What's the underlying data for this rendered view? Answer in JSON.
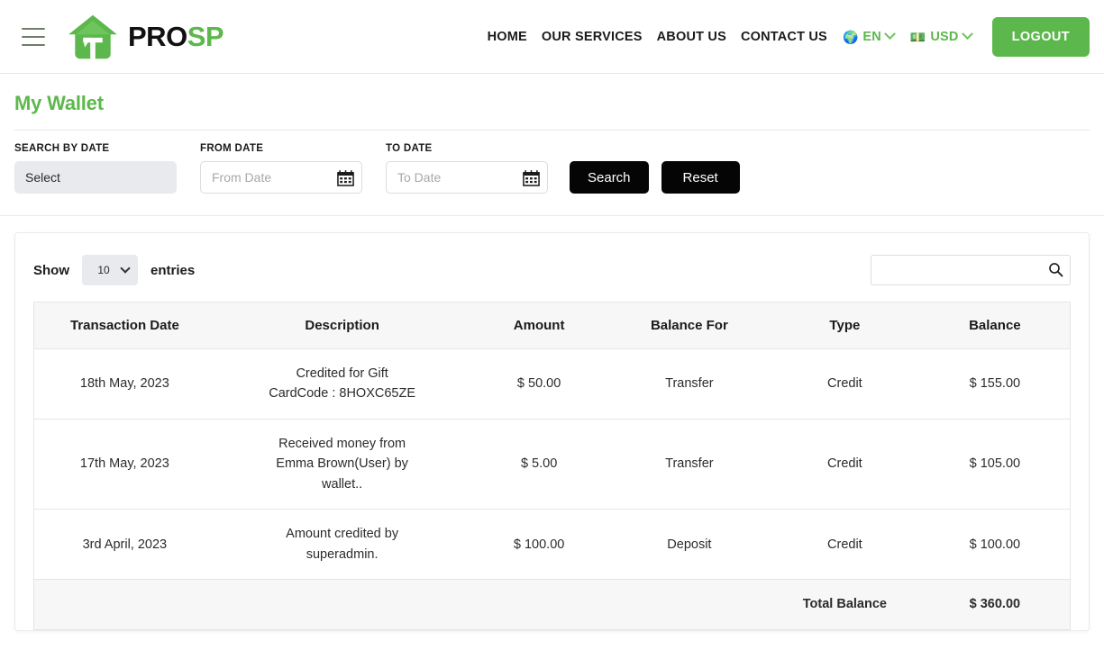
{
  "header": {
    "menu_icon": "hamburger-icon",
    "brand": {
      "part1": "PRO",
      "part2": "SP",
      "logo_icon": "house-tool-logo-icon"
    },
    "nav": [
      {
        "label": "HOME"
      },
      {
        "label": "OUR SERVICES"
      },
      {
        "label": "ABOUT US"
      },
      {
        "label": "CONTACT US"
      }
    ],
    "language": {
      "emoji": "🌍",
      "code": "EN",
      "icon": "globe-icon"
    },
    "currency": {
      "emoji": "💵",
      "code": "USD",
      "icon": "banknote-icon"
    },
    "logout_label": "LOGOUT"
  },
  "page": {
    "title": "My Wallet"
  },
  "filters": {
    "search_by_date": {
      "label": "SEARCH BY DATE",
      "value": "Select"
    },
    "from_date": {
      "label": "FROM DATE",
      "placeholder": "From Date",
      "value": "",
      "icon": "calendar-icon"
    },
    "to_date": {
      "label": "TO DATE",
      "placeholder": "To Date",
      "value": "",
      "icon": "calendar-icon"
    },
    "search_label": "Search",
    "reset_label": "Reset"
  },
  "table_controls": {
    "show_label": "Show",
    "entries_label": "entries",
    "page_length": "10",
    "search_value": "",
    "search_placeholder": "",
    "search_icon": "search-icon"
  },
  "table": {
    "columns": [
      "Transaction Date",
      "Description",
      "Amount",
      "Balance For",
      "Type",
      "Balance"
    ],
    "rows": [
      {
        "date": "18th May, 2023",
        "description_line1": "Credited for Gift",
        "description_line2": "CardCode : 8HOXC65ZE",
        "amount": "$ 50.00",
        "balance_for": "Transfer",
        "type": "Credit",
        "balance": "$ 155.00"
      },
      {
        "date": "17th May, 2023",
        "description_line1": "Received money from",
        "description_line2": "Emma Brown(User) by",
        "description_line3": "wallet..",
        "amount": "$ 5.00",
        "balance_for": "Transfer",
        "type": "Credit",
        "balance": "$ 105.00"
      },
      {
        "date": "3rd April, 2023",
        "description_line1": "Amount credited by",
        "description_line2": "superadmin.",
        "amount": "$ 100.00",
        "balance_for": "Deposit",
        "type": "Credit",
        "balance": "$ 100.00"
      }
    ],
    "total": {
      "label": "Total Balance",
      "value": "$ 360.00"
    }
  },
  "colors": {
    "brand_green": "#5cb84c",
    "dark_button": "#050505",
    "header_row_bg": "#f7f7f7",
    "select_bg": "#e9eaee"
  }
}
